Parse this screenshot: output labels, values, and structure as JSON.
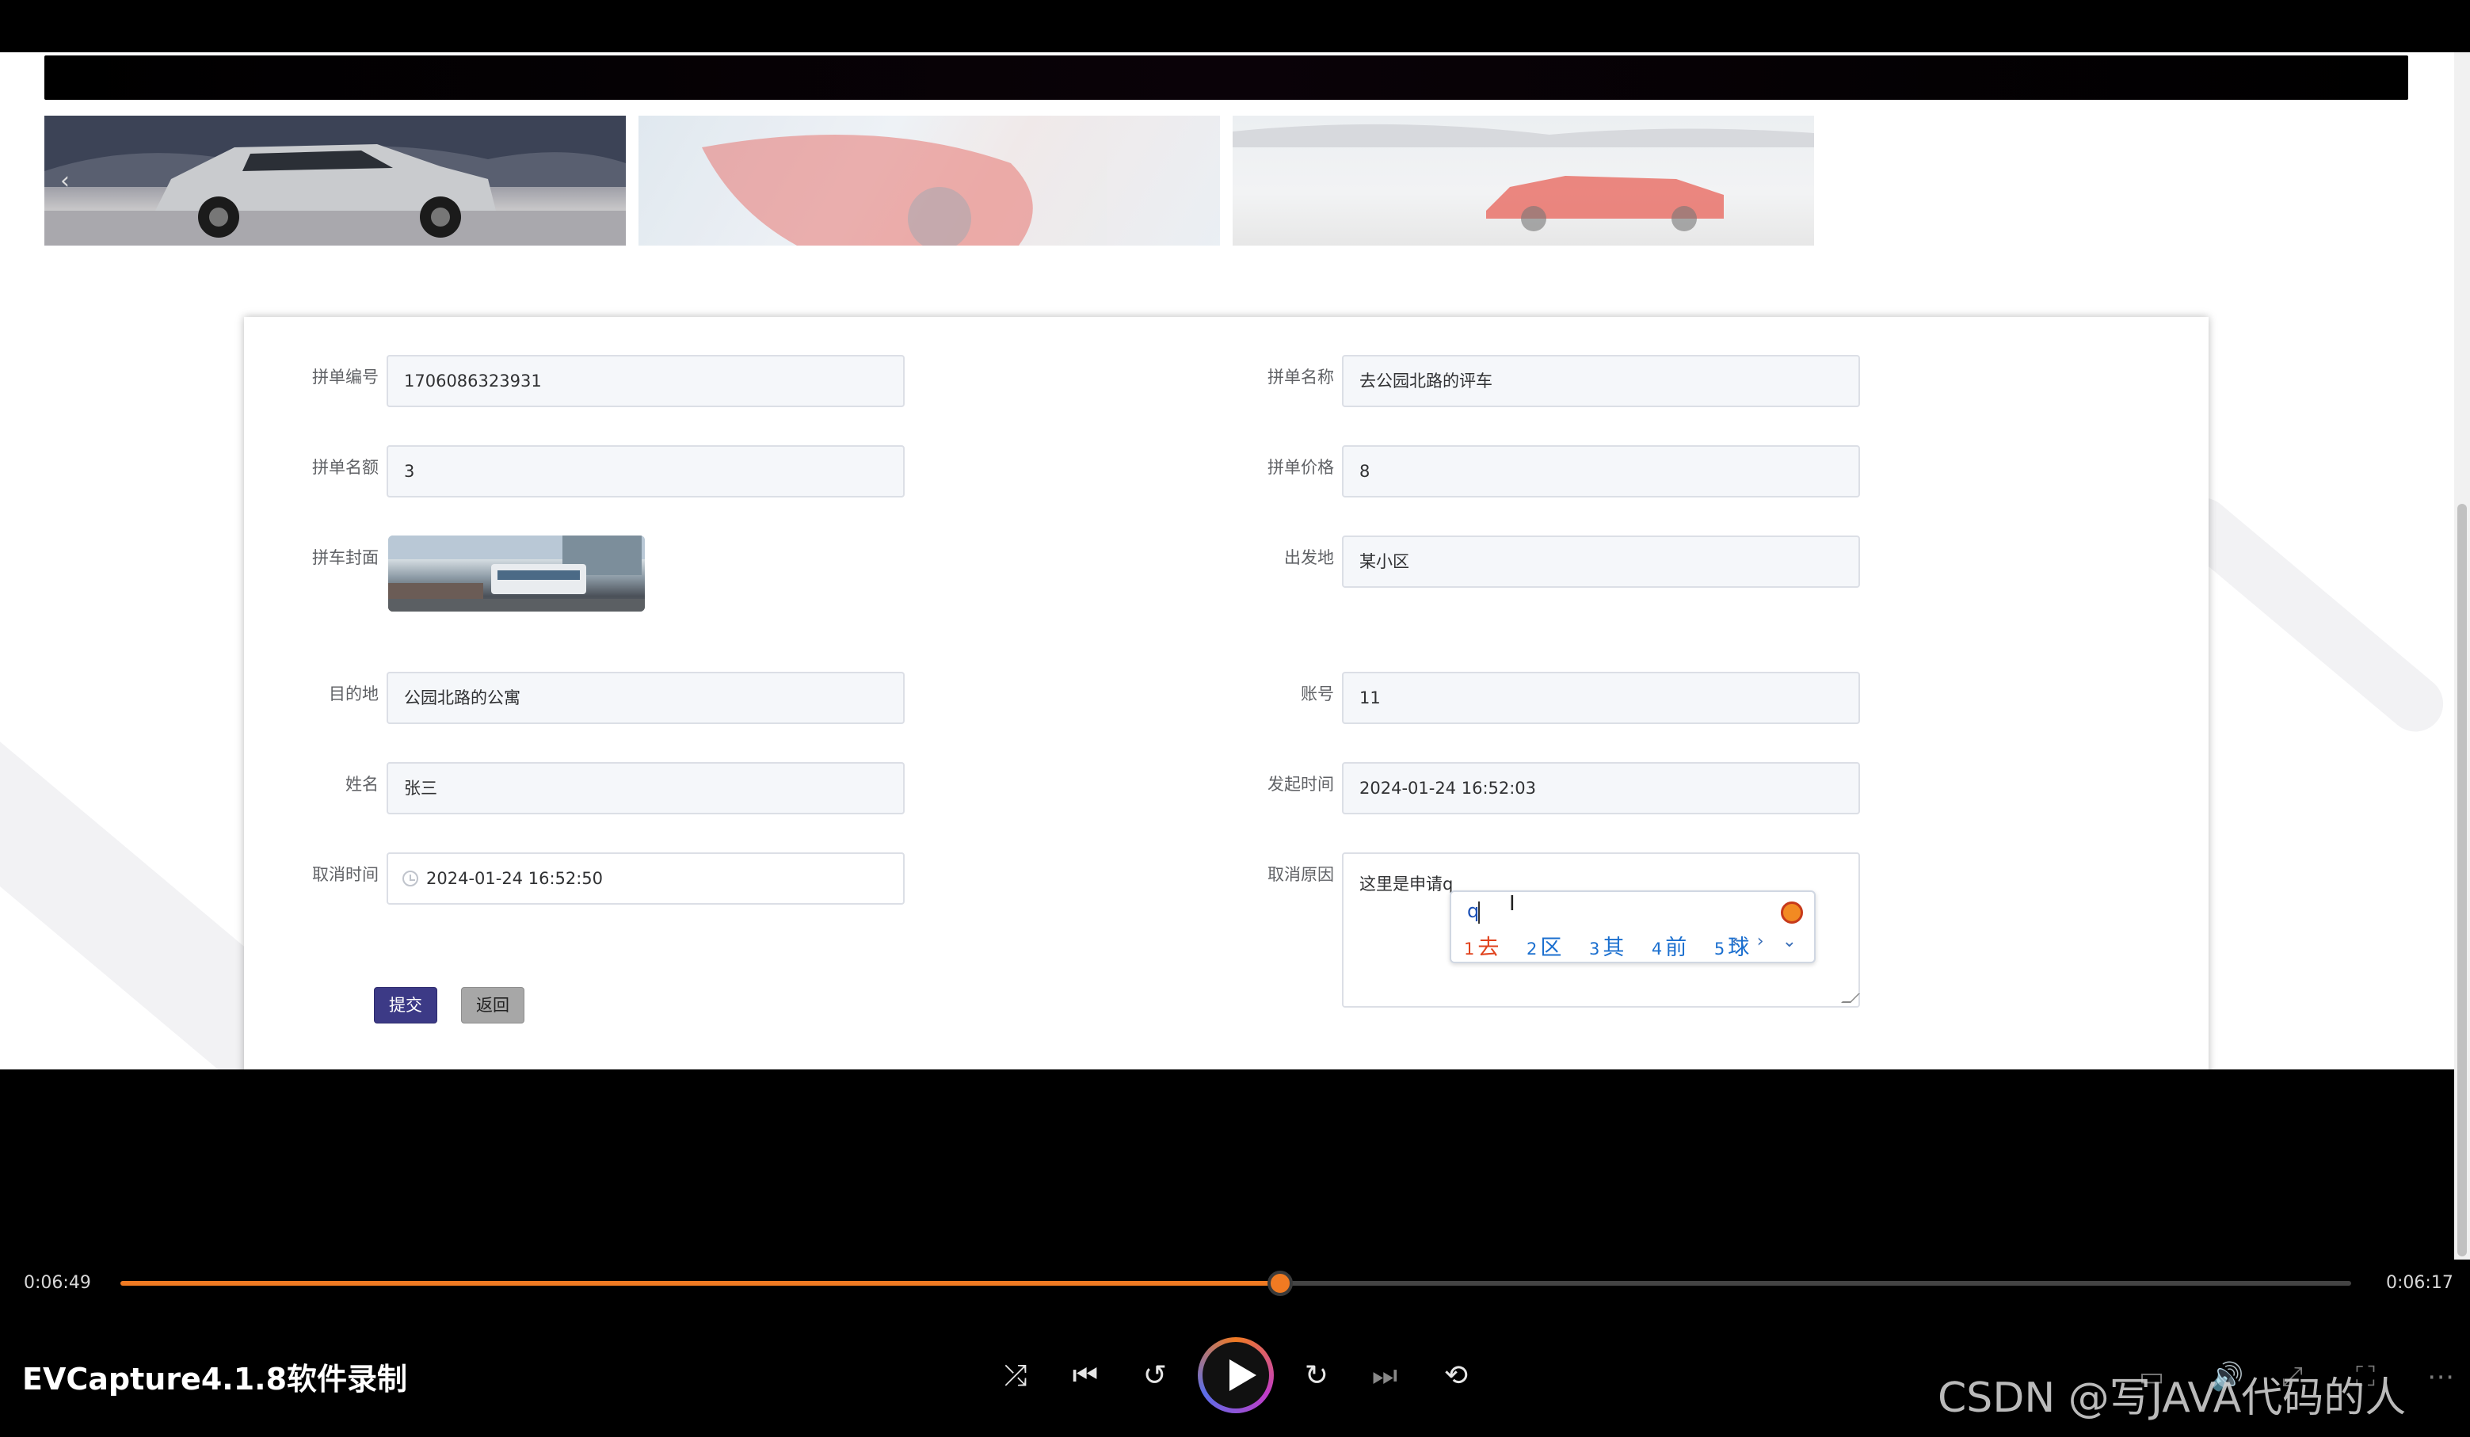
{
  "form": {
    "order_no_label": "拼单编号",
    "order_no": "1706086323931",
    "order_name_label": "拼单名称",
    "order_name": "去公园北路的评车",
    "slots_label": "拼单名额",
    "slots": "3",
    "price_label": "拼单价格",
    "price": "8",
    "cover_label": "拼车封面",
    "origin_label": "出发地",
    "origin": "某小区",
    "destination_label": "目的地",
    "destination": "公园北路的公寓",
    "account_label": "账号",
    "account": "11",
    "name_label": "姓名",
    "name": "张三",
    "created_label": "发起时间",
    "created": "2024-01-24 16:52:03",
    "cancel_time_label": "取消时间",
    "cancel_time": "2024-01-24 16:52:50",
    "cancel_reason_label": "取消原因",
    "cancel_reason": "这里是申请q",
    "submit_label": "提交",
    "back_label": "返回"
  },
  "ime": {
    "composition": "q",
    "candidates": [
      {
        "num": "1",
        "text": "去"
      },
      {
        "num": "2",
        "text": "区"
      },
      {
        "num": "3",
        "text": "其"
      },
      {
        "num": "4",
        "text": "前"
      },
      {
        "num": "5",
        "text": "球"
      }
    ],
    "nav": "‹ › ⌄"
  },
  "player": {
    "current_time": "0:06:49",
    "remaining_time": "0:06:17",
    "progress_fraction": 0.52,
    "recorder_label": "EVCapture4.1.8软件录制",
    "watermark": "CSDN @写JAVA代码的人",
    "accent_color": "#f07a22"
  }
}
